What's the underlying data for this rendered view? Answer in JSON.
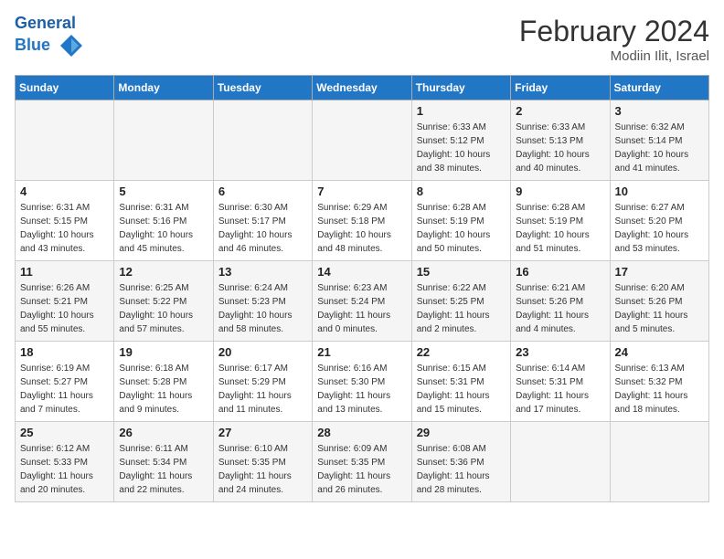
{
  "header": {
    "logo_line1": "General",
    "logo_line2": "Blue",
    "month_title": "February 2024",
    "location": "Modiin Ilit, Israel"
  },
  "weekdays": [
    "Sunday",
    "Monday",
    "Tuesday",
    "Wednesday",
    "Thursday",
    "Friday",
    "Saturday"
  ],
  "weeks": [
    [
      {
        "day": "",
        "sunrise": "",
        "sunset": "",
        "daylight": ""
      },
      {
        "day": "",
        "sunrise": "",
        "sunset": "",
        "daylight": ""
      },
      {
        "day": "",
        "sunrise": "",
        "sunset": "",
        "daylight": ""
      },
      {
        "day": "",
        "sunrise": "",
        "sunset": "",
        "daylight": ""
      },
      {
        "day": "1",
        "sunrise": "Sunrise: 6:33 AM",
        "sunset": "Sunset: 5:12 PM",
        "daylight": "Daylight: 10 hours and 38 minutes."
      },
      {
        "day": "2",
        "sunrise": "Sunrise: 6:33 AM",
        "sunset": "Sunset: 5:13 PM",
        "daylight": "Daylight: 10 hours and 40 minutes."
      },
      {
        "day": "3",
        "sunrise": "Sunrise: 6:32 AM",
        "sunset": "Sunset: 5:14 PM",
        "daylight": "Daylight: 10 hours and 41 minutes."
      }
    ],
    [
      {
        "day": "4",
        "sunrise": "Sunrise: 6:31 AM",
        "sunset": "Sunset: 5:15 PM",
        "daylight": "Daylight: 10 hours and 43 minutes."
      },
      {
        "day": "5",
        "sunrise": "Sunrise: 6:31 AM",
        "sunset": "Sunset: 5:16 PM",
        "daylight": "Daylight: 10 hours and 45 minutes."
      },
      {
        "day": "6",
        "sunrise": "Sunrise: 6:30 AM",
        "sunset": "Sunset: 5:17 PM",
        "daylight": "Daylight: 10 hours and 46 minutes."
      },
      {
        "day": "7",
        "sunrise": "Sunrise: 6:29 AM",
        "sunset": "Sunset: 5:18 PM",
        "daylight": "Daylight: 10 hours and 48 minutes."
      },
      {
        "day": "8",
        "sunrise": "Sunrise: 6:28 AM",
        "sunset": "Sunset: 5:19 PM",
        "daylight": "Daylight: 10 hours and 50 minutes."
      },
      {
        "day": "9",
        "sunrise": "Sunrise: 6:28 AM",
        "sunset": "Sunset: 5:19 PM",
        "daylight": "Daylight: 10 hours and 51 minutes."
      },
      {
        "day": "10",
        "sunrise": "Sunrise: 6:27 AM",
        "sunset": "Sunset: 5:20 PM",
        "daylight": "Daylight: 10 hours and 53 minutes."
      }
    ],
    [
      {
        "day": "11",
        "sunrise": "Sunrise: 6:26 AM",
        "sunset": "Sunset: 5:21 PM",
        "daylight": "Daylight: 10 hours and 55 minutes."
      },
      {
        "day": "12",
        "sunrise": "Sunrise: 6:25 AM",
        "sunset": "Sunset: 5:22 PM",
        "daylight": "Daylight: 10 hours and 57 minutes."
      },
      {
        "day": "13",
        "sunrise": "Sunrise: 6:24 AM",
        "sunset": "Sunset: 5:23 PM",
        "daylight": "Daylight: 10 hours and 58 minutes."
      },
      {
        "day": "14",
        "sunrise": "Sunrise: 6:23 AM",
        "sunset": "Sunset: 5:24 PM",
        "daylight": "Daylight: 11 hours and 0 minutes."
      },
      {
        "day": "15",
        "sunrise": "Sunrise: 6:22 AM",
        "sunset": "Sunset: 5:25 PM",
        "daylight": "Daylight: 11 hours and 2 minutes."
      },
      {
        "day": "16",
        "sunrise": "Sunrise: 6:21 AM",
        "sunset": "Sunset: 5:26 PM",
        "daylight": "Daylight: 11 hours and 4 minutes."
      },
      {
        "day": "17",
        "sunrise": "Sunrise: 6:20 AM",
        "sunset": "Sunset: 5:26 PM",
        "daylight": "Daylight: 11 hours and 5 minutes."
      }
    ],
    [
      {
        "day": "18",
        "sunrise": "Sunrise: 6:19 AM",
        "sunset": "Sunset: 5:27 PM",
        "daylight": "Daylight: 11 hours and 7 minutes."
      },
      {
        "day": "19",
        "sunrise": "Sunrise: 6:18 AM",
        "sunset": "Sunset: 5:28 PM",
        "daylight": "Daylight: 11 hours and 9 minutes."
      },
      {
        "day": "20",
        "sunrise": "Sunrise: 6:17 AM",
        "sunset": "Sunset: 5:29 PM",
        "daylight": "Daylight: 11 hours and 11 minutes."
      },
      {
        "day": "21",
        "sunrise": "Sunrise: 6:16 AM",
        "sunset": "Sunset: 5:30 PM",
        "daylight": "Daylight: 11 hours and 13 minutes."
      },
      {
        "day": "22",
        "sunrise": "Sunrise: 6:15 AM",
        "sunset": "Sunset: 5:31 PM",
        "daylight": "Daylight: 11 hours and 15 minutes."
      },
      {
        "day": "23",
        "sunrise": "Sunrise: 6:14 AM",
        "sunset": "Sunset: 5:31 PM",
        "daylight": "Daylight: 11 hours and 17 minutes."
      },
      {
        "day": "24",
        "sunrise": "Sunrise: 6:13 AM",
        "sunset": "Sunset: 5:32 PM",
        "daylight": "Daylight: 11 hours and 18 minutes."
      }
    ],
    [
      {
        "day": "25",
        "sunrise": "Sunrise: 6:12 AM",
        "sunset": "Sunset: 5:33 PM",
        "daylight": "Daylight: 11 hours and 20 minutes."
      },
      {
        "day": "26",
        "sunrise": "Sunrise: 6:11 AM",
        "sunset": "Sunset: 5:34 PM",
        "daylight": "Daylight: 11 hours and 22 minutes."
      },
      {
        "day": "27",
        "sunrise": "Sunrise: 6:10 AM",
        "sunset": "Sunset: 5:35 PM",
        "daylight": "Daylight: 11 hours and 24 minutes."
      },
      {
        "day": "28",
        "sunrise": "Sunrise: 6:09 AM",
        "sunset": "Sunset: 5:35 PM",
        "daylight": "Daylight: 11 hours and 26 minutes."
      },
      {
        "day": "29",
        "sunrise": "Sunrise: 6:08 AM",
        "sunset": "Sunset: 5:36 PM",
        "daylight": "Daylight: 11 hours and 28 minutes."
      },
      {
        "day": "",
        "sunrise": "",
        "sunset": "",
        "daylight": ""
      },
      {
        "day": "",
        "sunrise": "",
        "sunset": "",
        "daylight": ""
      }
    ]
  ]
}
